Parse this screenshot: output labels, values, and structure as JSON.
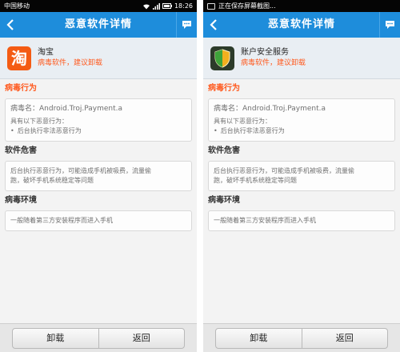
{
  "left": {
    "status": {
      "carrier": "中国移动",
      "time": "18:26"
    },
    "header": {
      "title": "恶意软件详情"
    },
    "app": {
      "name": "淘宝",
      "warning": "病毒软件，建议卸载",
      "icon_char": "淘",
      "icon": "taobao-icon"
    },
    "sections": {
      "behavior_title": "病毒行为",
      "virus_name": "病毒名：Android.Troj.Payment.a",
      "has_following": "具有以下恶意行为：",
      "behavior_item": "后台执行非法恶意行为",
      "harm_title": "软件危害",
      "harm_line1": "后台执行恶意行为，可能造成手机被吸费，流量偷",
      "harm_line2": "跑，破坏手机系统稳定等问题",
      "env_title": "病毒环境",
      "env_text": "一般随着第三方安装程序而进入手机"
    },
    "buttons": {
      "uninstall": "卸载",
      "back": "返回"
    }
  },
  "right": {
    "status": {
      "text": "正在保存屏幕截图..."
    },
    "header": {
      "title": "恶意软件详情"
    },
    "app": {
      "name": "账户安全服务",
      "warning": "病毒软件，建议卸载",
      "icon": "shield-icon"
    },
    "sections": {
      "behavior_title": "病毒行为",
      "virus_name": "病毒名：Android.Troj.Payment.a",
      "has_following": "具有以下恶意行为：",
      "behavior_item": "后台执行非法恶意行为",
      "harm_title": "软件危害",
      "harm_line1": "后台执行恶意行为，可能造成手机被吸费，流量偷",
      "harm_line2": "跑，破坏手机系统稳定等问题",
      "env_title": "病毒环境",
      "env_text": "一般随着第三方安装程序而进入手机"
    },
    "buttons": {
      "uninstall": "卸载",
      "back": "返回"
    }
  },
  "colors": {
    "titlebar": "#1e8ddb",
    "warning": "#ff5a1f",
    "appcard": "#e9eef3"
  }
}
